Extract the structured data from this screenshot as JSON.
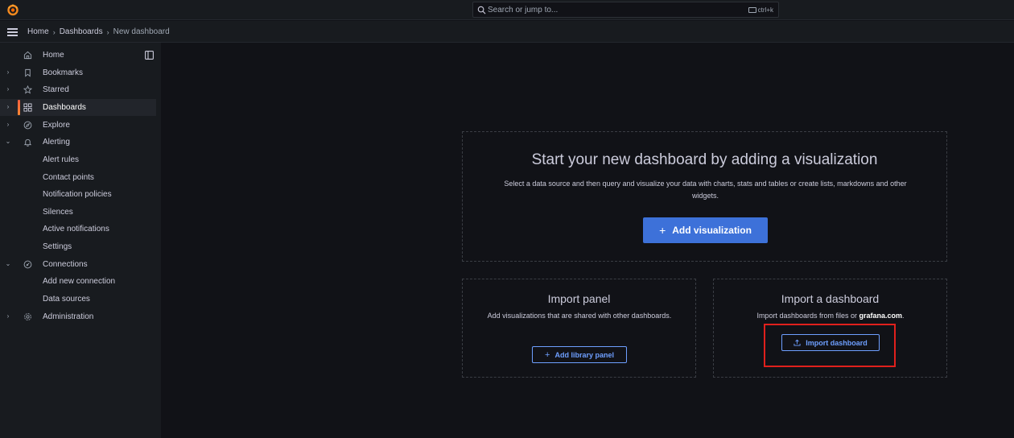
{
  "topbar": {
    "logo": "grafana-logo-icon",
    "search_placeholder": "Search or jump to...",
    "shortcut": "ctrl+k"
  },
  "breadcrumb": [
    "Home",
    "Dashboards",
    "New dashboard"
  ],
  "sidebar": {
    "items": [
      {
        "label": "Home",
        "icon": "home-icon",
        "chevron": ""
      },
      {
        "label": "Bookmarks",
        "icon": "bookmark-icon",
        "chevron": "›"
      },
      {
        "label": "Starred",
        "icon": "star-icon",
        "chevron": "›"
      },
      {
        "label": "Dashboards",
        "icon": "apps-icon",
        "chevron": "›",
        "active": true
      },
      {
        "label": "Explore",
        "icon": "compass-icon",
        "chevron": "›"
      },
      {
        "label": "Alerting",
        "icon": "bell-icon",
        "chevron": "⌄"
      },
      {
        "label": "Alert rules"
      },
      {
        "label": "Contact points"
      },
      {
        "label": "Notification policies"
      },
      {
        "label": "Silences"
      },
      {
        "label": "Active notifications"
      },
      {
        "label": "Settings"
      },
      {
        "label": "Connections",
        "icon": "plug-icon",
        "chevron": "⌄"
      },
      {
        "label": "Add new connection"
      },
      {
        "label": "Data sources"
      },
      {
        "label": "Administration",
        "icon": "cog-icon",
        "chevron": "›"
      }
    ]
  },
  "main": {
    "visualization": {
      "title": "Start your new dashboard by adding a visualization",
      "description": "Select a data source and then query and visualize your data with charts, stats and tables or create lists, markdowns and other widgets.",
      "button_label": "Add visualization"
    },
    "import_panel": {
      "title": "Import panel",
      "description": "Add visualizations that are shared with other dashboards.",
      "button_label": "Add library panel"
    },
    "import_dashboard": {
      "title": "Import a dashboard",
      "description_prefix": "Import dashboards from files or ",
      "description_link": "grafana.com",
      "description_suffix": ".",
      "button_label": "Import dashboard"
    }
  },
  "colors": {
    "accent": "#3d71d9",
    "link": "#6e9fff",
    "highlight": "#e0201c",
    "active_bar": "#f55f3e"
  }
}
